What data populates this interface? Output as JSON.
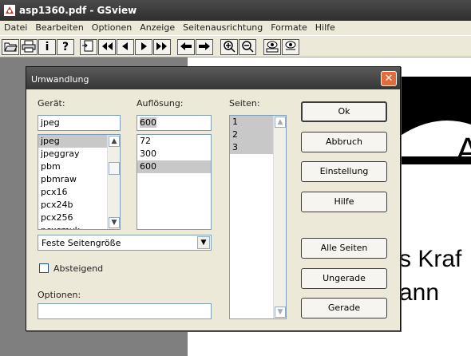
{
  "window": {
    "title": "asp1360.pdf - GSview"
  },
  "menu": [
    "Datei",
    "Bearbeiten",
    "Optionen",
    "Anzeige",
    "Seitenausrichtung",
    "Formate",
    "Hilfe"
  ],
  "toolbar": {
    "icons": [
      "open-icon",
      "print-icon",
      "info-icon",
      "help-icon",
      "goto-page-icon",
      "first-page-icon",
      "prev-page-icon",
      "next-page-icon",
      "last-page-icon",
      "back-icon",
      "forward-icon",
      "zoom-in-icon",
      "zoom-out-icon",
      "view-full-icon",
      "view-magnify-icon"
    ],
    "info_glyph": "i",
    "help_glyph": "?"
  },
  "document": {
    "big_letter": "A",
    "line1": "s Kraf",
    "line2": "ann"
  },
  "dialog": {
    "title": "Umwandlung",
    "device_label": "Gerät:",
    "device_value": "jpeg",
    "devices": [
      "jpeg",
      "jpeggray",
      "pbm",
      "pbmraw",
      "pcx16",
      "pcx24b",
      "pcx256",
      "pcxcmyk"
    ],
    "resolution_label": "Auflösung:",
    "resolution_value": "600",
    "resolutions": [
      "72",
      "300",
      "600"
    ],
    "pages_label": "Seiten:",
    "pages": [
      "1",
      "2",
      "3"
    ],
    "page_size_value": "Feste Seitengröße",
    "descending_label": "Absteigend",
    "descending_checked": false,
    "options_label": "Optionen:",
    "options_value": "",
    "buttons": {
      "ok": "Ok",
      "cancel": "Abbruch",
      "settings": "Einstellung",
      "help": "Hilfe",
      "all_pages": "Alle Seiten",
      "odd": "Ungerade",
      "even": "Gerade"
    }
  }
}
